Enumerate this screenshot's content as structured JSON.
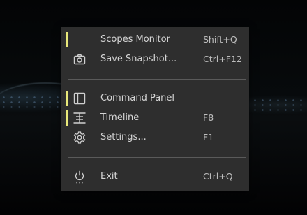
{
  "menu": {
    "items": [
      {
        "label": "Scopes Monitor",
        "shortcut": "Shift+Q",
        "icon": "none",
        "marker": true
      },
      {
        "label": "Save Snapshot...",
        "shortcut": "Ctrl+F12",
        "icon": "camera-icon",
        "marker": false
      },
      {
        "label": "Command Panel",
        "shortcut": "",
        "icon": "panel-icon",
        "marker": true
      },
      {
        "label": "Timeline",
        "shortcut": "F8",
        "icon": "timeline-icon",
        "marker": true
      },
      {
        "label": "Settings...",
        "shortcut": "F1",
        "icon": "gear-icon",
        "marker": false
      },
      {
        "label": "Exit",
        "shortcut": "Ctrl+Q",
        "icon": "power-icon",
        "marker": false
      }
    ]
  },
  "colors": {
    "menu_background": "#2e2e2e",
    "active_marker": "#e8e87a",
    "label_text": "#d6d6d6",
    "shortcut_text": "#bdbdbd",
    "separator": "#5a5a5a"
  }
}
